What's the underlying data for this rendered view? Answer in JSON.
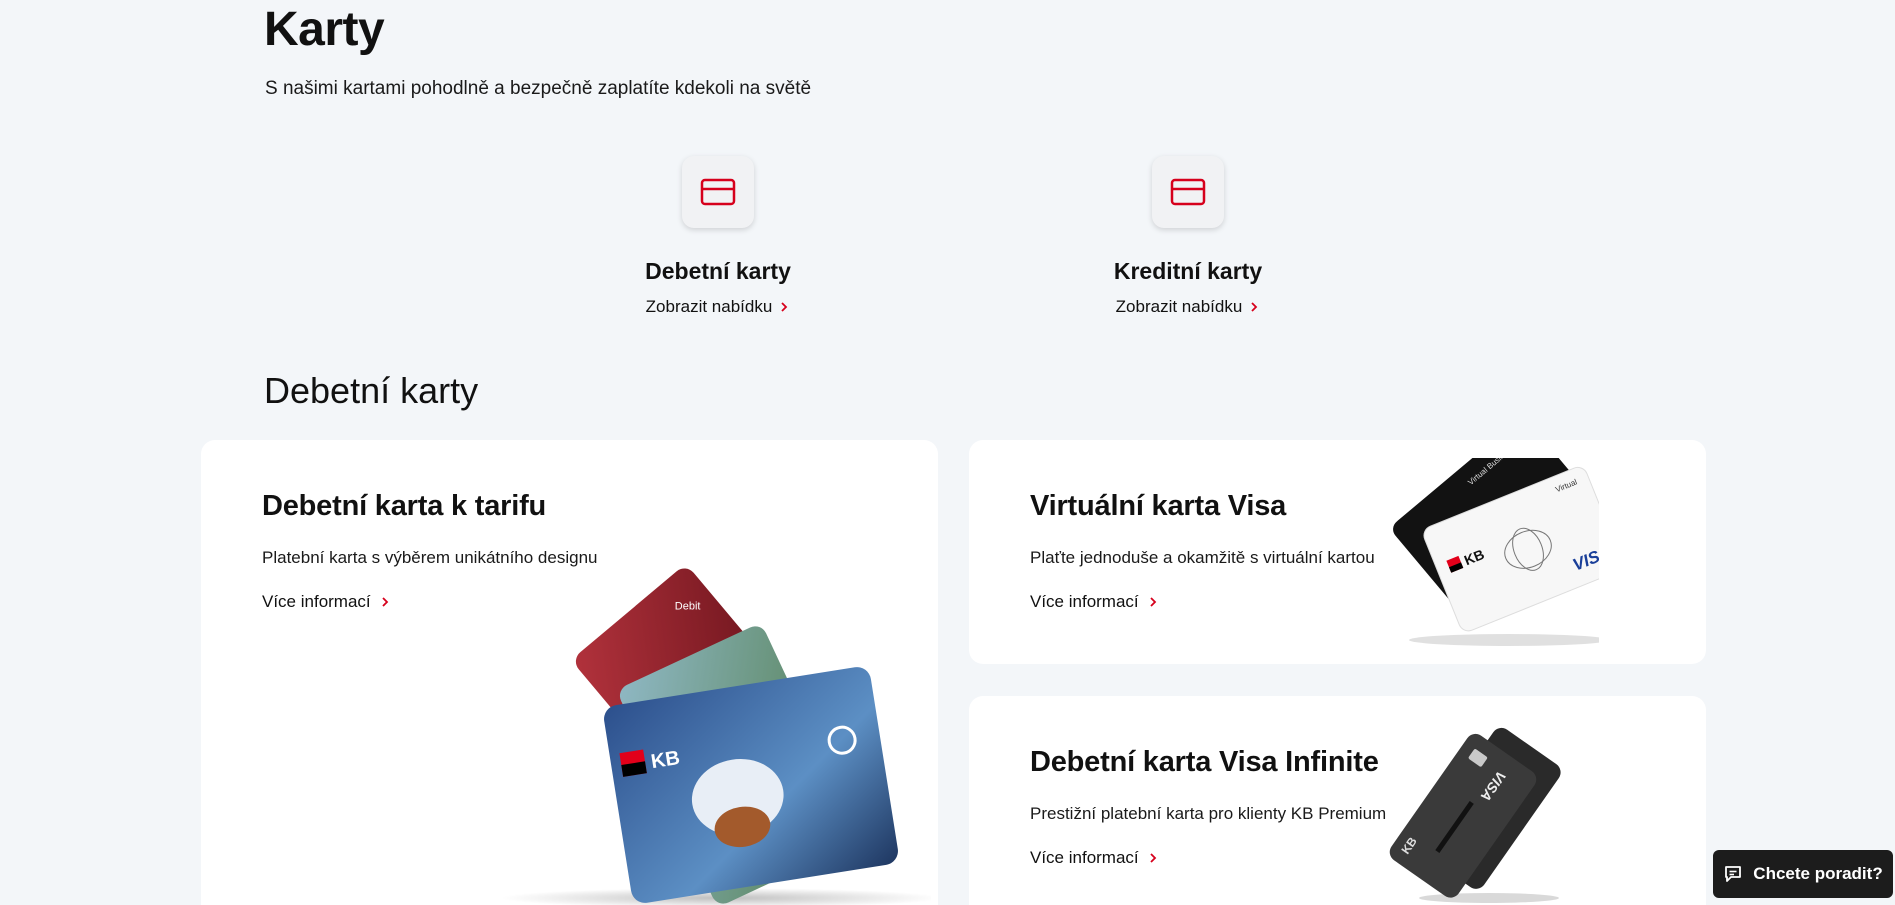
{
  "page": {
    "title": "Karty",
    "subtitle": "S našimi kartami pohodlně a bezpečně zaplatíte kdekoli na světě"
  },
  "categories": [
    {
      "title": "Debetní karty",
      "link": "Zobrazit nabídku",
      "icon": "credit-card-icon"
    },
    {
      "title": "Kreditní karty",
      "link": "Zobrazit nabídku",
      "icon": "credit-card-icon"
    }
  ],
  "section": {
    "title": "Debetní karty"
  },
  "products": [
    {
      "title": "Debetní karta k tarifu",
      "description": "Platební karta s výběrem unikátního designu",
      "link": "Více informací",
      "card_labels": {
        "brand": "KB",
        "type": "Debit"
      }
    },
    {
      "title": "Virtuální karta Visa",
      "description": "Plaťte jednoduše a okamžitě s virtuální kartou",
      "link": "Více informací",
      "card_labels": {
        "brand": "KB",
        "network": "VISA",
        "tag": "Virtual",
        "tag2": "Virtual Business"
      }
    },
    {
      "title": "Debetní karta Visa Infinite",
      "description": "Prestižní platební karta pro klienty KB Premium",
      "link": "Více informací",
      "card_labels": {
        "brand": "KB",
        "network": "VISA"
      }
    }
  ],
  "help_button": {
    "label": "Chcete poradit?",
    "icon": "chat-icon"
  },
  "colors": {
    "accent": "#d6001c",
    "background": "#f3f6f9",
    "card": "#ffffff",
    "dark": "#1c1c1c"
  }
}
